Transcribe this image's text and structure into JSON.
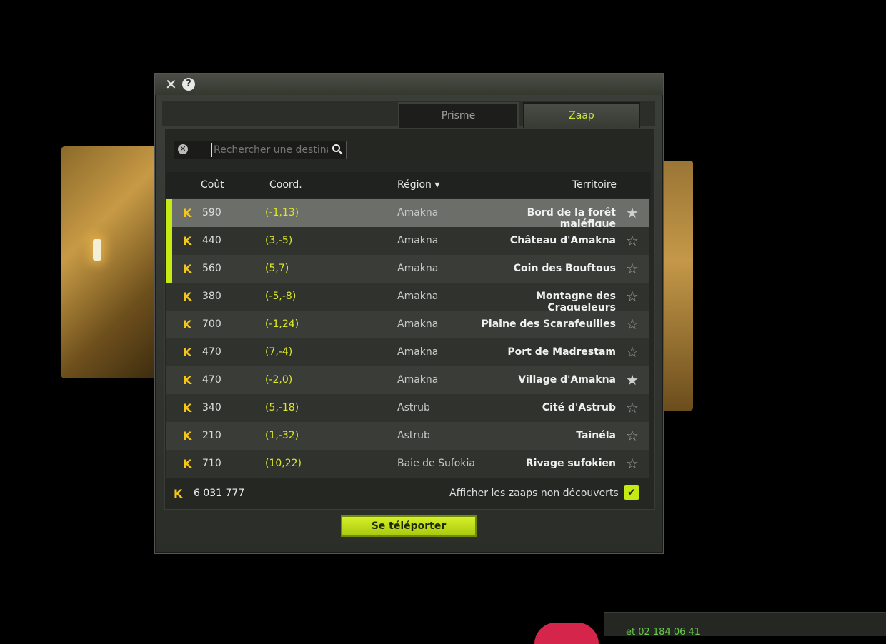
{
  "window": {
    "close_label": "✕",
    "help_label": "?",
    "tabs": [
      {
        "label": "Zaap",
        "active": true
      },
      {
        "label": "Prisme",
        "active": false
      }
    ]
  },
  "search": {
    "placeholder": "Rechercher une destination..."
  },
  "table": {
    "headers": {
      "territory": "Territoire",
      "region": "Région ▾",
      "coord": "Coord.",
      "cost": "Coût"
    },
    "rows": [
      {
        "territory": "Bord de la forêt maléfique",
        "region": "Amakna",
        "coord": "(-1,13)",
        "cost": "590",
        "favorite": true,
        "selected": true,
        "marked": true
      },
      {
        "territory": "Château d'Amakna",
        "region": "Amakna",
        "coord": "(3,-5)",
        "cost": "440",
        "favorite": false,
        "selected": false,
        "marked": true
      },
      {
        "territory": "Coin des Bouftous",
        "region": "Amakna",
        "coord": "(5,7)",
        "cost": "560",
        "favorite": false,
        "selected": false,
        "marked": true
      },
      {
        "territory": "Montagne des Craqueleurs",
        "region": "Amakna",
        "coord": "(-5,-8)",
        "cost": "380",
        "favorite": false,
        "selected": false,
        "marked": false
      },
      {
        "territory": "Plaine des Scarafeuilles",
        "region": "Amakna",
        "coord": "(-1,24)",
        "cost": "700",
        "favorite": false,
        "selected": false,
        "marked": false
      },
      {
        "territory": "Port de Madrestam",
        "region": "Amakna",
        "coord": "(7,-4)",
        "cost": "470",
        "favorite": false,
        "selected": false,
        "marked": false
      },
      {
        "territory": "Village d'Amakna",
        "region": "Amakna",
        "coord": "(-2,0)",
        "cost": "470",
        "favorite": true,
        "selected": false,
        "marked": false
      },
      {
        "territory": "Cité d'Astrub",
        "region": "Astrub",
        "coord": "(5,-18)",
        "cost": "340",
        "favorite": false,
        "selected": false,
        "marked": false
      },
      {
        "territory": "Tainéla",
        "region": "Astrub",
        "coord": "(1,-32)",
        "cost": "210",
        "favorite": false,
        "selected": false,
        "marked": false
      },
      {
        "territory": "Rivage sufokien",
        "region": "Baie de Sufokia",
        "coord": "(10,22)",
        "cost": "710",
        "favorite": false,
        "selected": false,
        "marked": false
      }
    ]
  },
  "footer": {
    "kamas_icon": "K",
    "kamas": "6 031 777",
    "undiscovered_label": "Afficher les zaaps non découverts",
    "chevron": "✔"
  },
  "teleport_label": "Se téléporter",
  "chat_text": "et 02 184 06 41",
  "colors": {
    "accent": "#c6ea14",
    "coord": "#dbe82a",
    "kamas": "#f5c518"
  }
}
